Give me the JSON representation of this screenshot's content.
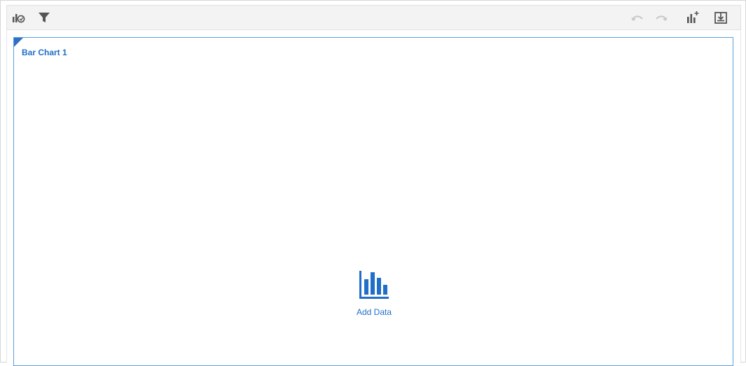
{
  "toolbar": {
    "left_icons": [
      {
        "icon": "chart-properties-icon",
        "color": "#555555"
      },
      {
        "icon": "filter-icon",
        "color": "#555555"
      }
    ],
    "right_icons": [
      {
        "icon": "undo-icon",
        "color": "#c8c8c8"
      },
      {
        "icon": "redo-icon",
        "color": "#c8c8c8"
      },
      {
        "icon": "add-visualization-icon",
        "color": "#555555"
      },
      {
        "icon": "save-download-icon",
        "color": "#555555"
      }
    ]
  },
  "chart_panel": {
    "title": "Bar Chart 1",
    "accent_color": "#1f6fc8",
    "add_data": {
      "label": "Add Data",
      "icon": "bar-chart-icon"
    }
  }
}
